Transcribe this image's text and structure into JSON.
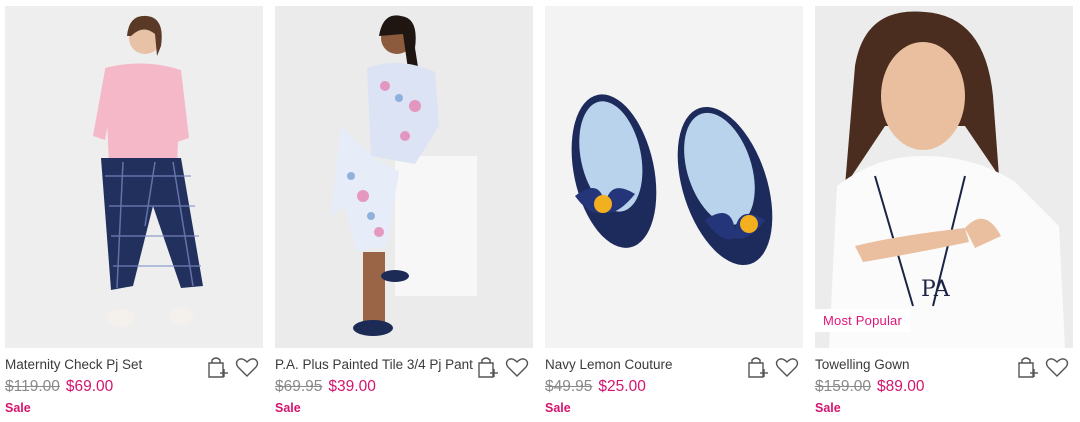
{
  "products": [
    {
      "name": "Maternity Check Pj Set",
      "was_price": "$119.00",
      "now_price": "$69.00",
      "tag": "Sale",
      "badge": ""
    },
    {
      "name": "P.A. Plus Painted Tile 3/4 Pj Pant",
      "was_price": "$69.95",
      "now_price": "$39.00",
      "tag": "Sale",
      "badge": ""
    },
    {
      "name": "Navy Lemon Couture",
      "was_price": "$49.95",
      "now_price": "$25.00",
      "tag": "Sale",
      "badge": ""
    },
    {
      "name": "Towelling Gown",
      "was_price": "$159.00",
      "now_price": "$89.00",
      "tag": "Sale",
      "badge": "Most Popular"
    }
  ],
  "icons": {
    "add_to_bag": "bag-plus-icon",
    "wishlist": "heart-icon"
  },
  "colors": {
    "sale_price": "#d4146f",
    "was_price": "#8a8a8a",
    "badge_text": "#e0157b"
  }
}
